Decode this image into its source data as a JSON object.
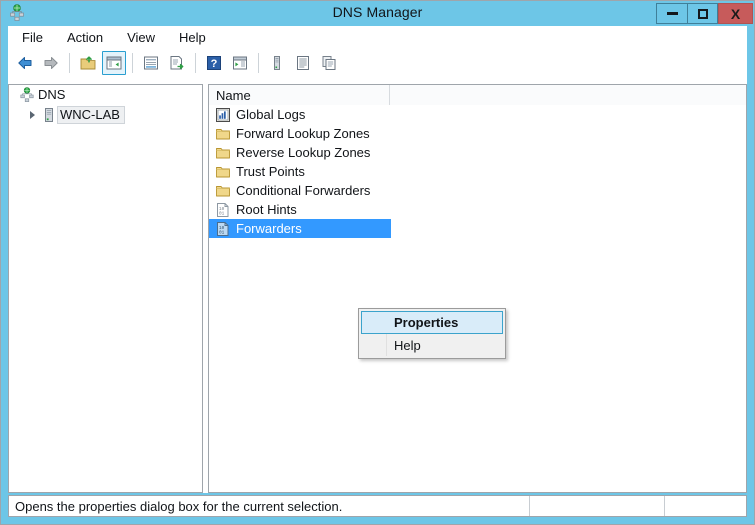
{
  "window": {
    "title": "DNS Manager",
    "icon": "dns-server-icon",
    "frame_color": "#6dc6e7",
    "controls": {
      "minimize": "minimize-button",
      "maximize": "maximize-button",
      "close_label": "X"
    }
  },
  "menubar": {
    "items": [
      {
        "label": "File"
      },
      {
        "label": "Action"
      },
      {
        "label": "View"
      },
      {
        "label": "Help"
      }
    ]
  },
  "toolbar": {
    "buttons": [
      {
        "name": "back-icon",
        "tooltip": "Back"
      },
      {
        "name": "forward-icon",
        "tooltip": "Forward"
      },
      {
        "name": "up-one-level-icon",
        "tooltip": "Up One Level"
      },
      {
        "name": "show-hide-tree-icon",
        "tooltip": "Show/Hide Console Tree",
        "active": true
      },
      {
        "name": "properties-icon",
        "tooltip": "Properties"
      },
      {
        "name": "export-list-icon",
        "tooltip": "Export List"
      },
      {
        "name": "help-icon",
        "tooltip": "Help"
      },
      {
        "name": "refresh-icon",
        "tooltip": "Refresh"
      },
      {
        "name": "new-server-icon",
        "tooltip": "New Server"
      },
      {
        "name": "list-view-icon",
        "tooltip": "View"
      },
      {
        "name": "copy-icon",
        "tooltip": "Copy"
      }
    ]
  },
  "tree": {
    "root": {
      "label": "DNS",
      "icon": "dns-root-icon"
    },
    "child": {
      "label": "WNC-LAB",
      "icon": "server-icon",
      "expandable": true,
      "inactive_selected": true
    }
  },
  "list": {
    "columns": [
      "Name",
      ""
    ],
    "rows": [
      {
        "label": "Global Logs",
        "icon": "global-logs-icon",
        "selected": false
      },
      {
        "label": "Forward Lookup Zones",
        "icon": "folder-icon",
        "selected": false
      },
      {
        "label": "Reverse Lookup Zones",
        "icon": "folder-icon",
        "selected": false
      },
      {
        "label": "Trust Points",
        "icon": "folder-icon",
        "selected": false
      },
      {
        "label": "Conditional Forwarders",
        "icon": "folder-icon",
        "selected": false
      },
      {
        "label": "Root Hints",
        "icon": "records-icon",
        "selected": false
      },
      {
        "label": "Forwarders",
        "icon": "records-icon",
        "selected": true
      }
    ],
    "selection_color": "#3399ff"
  },
  "context_menu": {
    "items": [
      {
        "label": "Properties",
        "highlighted": true
      },
      {
        "label": "Help",
        "highlighted": false
      }
    ]
  },
  "statusbar": {
    "message": "Opens the properties dialog box for the current selection.",
    "pane2": "",
    "pane3": ""
  }
}
